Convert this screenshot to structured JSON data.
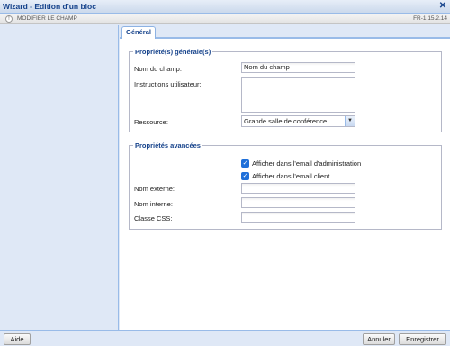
{
  "window": {
    "title": "Wizard - Edition d'un bloc"
  },
  "toolbar": {
    "action_label": "MODIFIER LE CHAMP",
    "version": "FR-1.15.2.14"
  },
  "tabs": [
    {
      "label": "Général",
      "active": true
    }
  ],
  "general_props": {
    "legend": "Propriété(s) générale(s)",
    "name_label": "Nom du champ:",
    "name_value": "Nom du champ",
    "instructions_label": "Instructions utilisateur:",
    "instructions_value": "",
    "resource_label": "Ressource:",
    "resource_selected": "Grande salle de conférence"
  },
  "advanced_props": {
    "legend": "Propriétés avancées",
    "checkbox_admin_label": "Afficher dans l'email d'administration",
    "checkbox_admin_checked": true,
    "checkbox_client_label": "Afficher dans l'email client",
    "checkbox_client_checked": true,
    "external_name_label": "Nom externe:",
    "external_name_value": "",
    "internal_name_label": "Nom interne:",
    "internal_name_value": "",
    "css_class_label": "Classe CSS:",
    "css_class_value": ""
  },
  "footer": {
    "help_label": "Aide",
    "cancel_label": "Annuler",
    "save_label": "Enregistrer"
  }
}
